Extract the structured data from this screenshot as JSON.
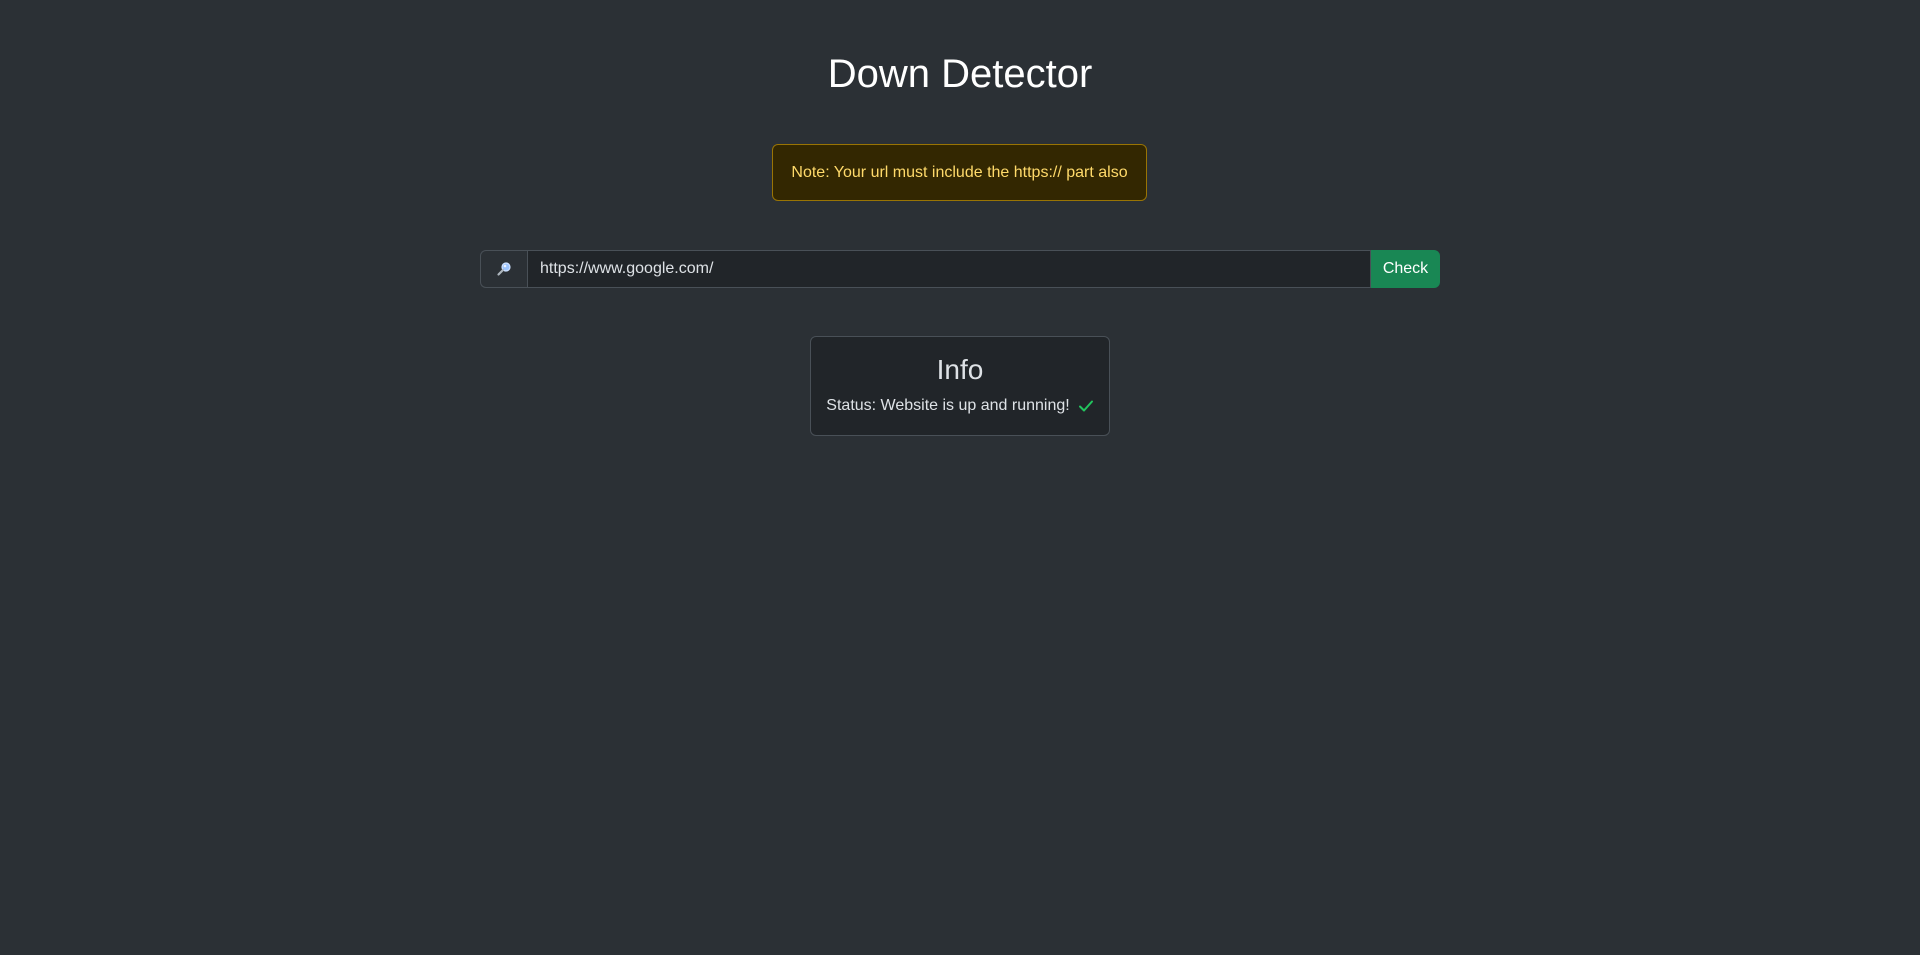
{
  "header": {
    "title": "Down Detector"
  },
  "alert": {
    "text": "Note: Your url must include the https:// part also",
    "colors": {
      "background": "#332701",
      "border": "#997404",
      "text": "#ffda6a"
    }
  },
  "search": {
    "icon": "magnifier-icon",
    "value": "https://www.google.com/",
    "button_label": "Check",
    "button_color": "#198754"
  },
  "info": {
    "title": "Info",
    "status_text": "Status: Website is up and running!",
    "status_icon": "check-icon",
    "status_color": "#22c55e"
  }
}
